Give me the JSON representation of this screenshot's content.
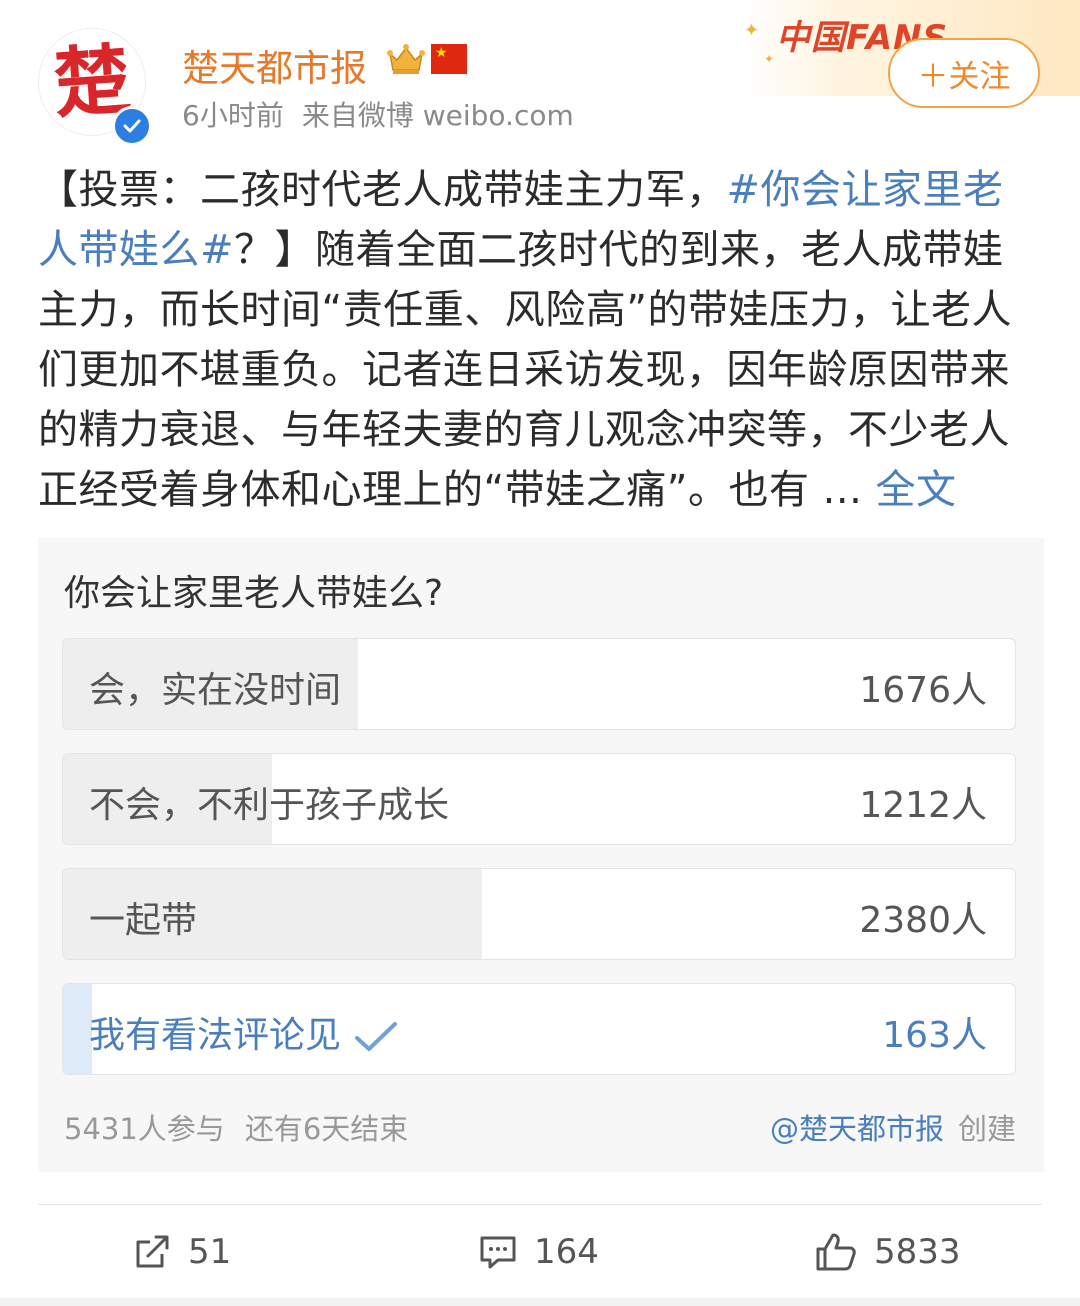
{
  "post": {
    "author": "楚天都市报",
    "time": "6小时前",
    "source": "来自微博 weibo.com",
    "follow_label": "＋关注",
    "fans_logo": "中国FANS",
    "avatar_char": "楚",
    "text_prefix": "【投票：二孩时代老人成带娃主力军，",
    "hashtag": "#你会让家里老人带娃么#",
    "text_body": "？】随着全面二孩时代的到来，老人成带娃主力，而长时间“责任重、风险高”的带娃压力，让老人们更加不堪重负。记者连日采访发现，因年龄原因带来的精力衰退、与年轻夫妻的育儿观念冲突等，不少老人正经受着身体和心理上的“带娃之痛”。也有 ... ",
    "more_label": "全文"
  },
  "poll": {
    "question": "你会让家里老人带娃么?",
    "options": [
      {
        "label": "会，实在没时间",
        "count": "1676人",
        "share": 0.31
      },
      {
        "label": "不会，不利于孩子成长",
        "count": "1212人",
        "share": 0.22
      },
      {
        "label": "一起带",
        "count": "2380人",
        "share": 0.44
      },
      {
        "label": "我有看法评论见",
        "count": "163人",
        "share": 0.03,
        "selected": true
      }
    ],
    "participants": "5431人参与",
    "remaining": "还有6天结束",
    "creator": "@楚天都市报",
    "created_label": "创建"
  },
  "actions": {
    "repost_count": "51",
    "comment_count": "164",
    "like_count": "5833"
  },
  "colors": {
    "accent_link": "#4a7ebd",
    "username": "#e8792a",
    "follow": "#f08a28"
  }
}
